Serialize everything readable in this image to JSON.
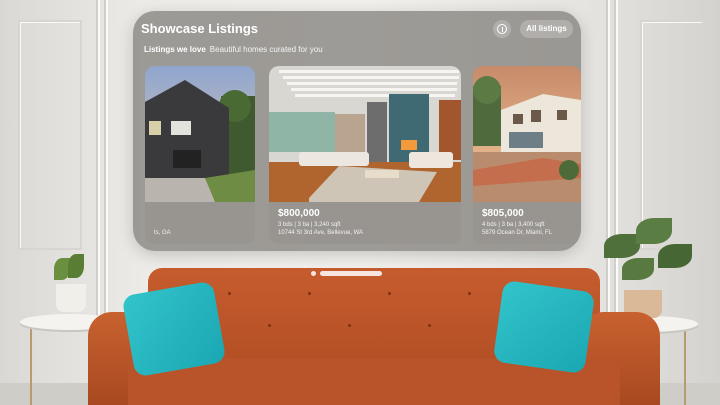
{
  "window": {
    "title": "Showcase Listings",
    "info_icon": "info-icon",
    "all_listings_label": "All listings"
  },
  "section": {
    "heading": "Listings we love",
    "subheading": "Beautiful homes curated for you"
  },
  "listings": [
    {
      "price": "",
      "specs": "",
      "address": "ts, GA",
      "photo": "modern two-story house with dark siding"
    },
    {
      "price": "$800,000",
      "specs": "3 bds | 3 ba | 3,240 sqft",
      "address": "10744 St 3rd Ave, Bellevue, WA",
      "photo": "open living room with fireplace"
    },
    {
      "price": "$805,000",
      "specs": "4 bds | 3 ba | 3,400 sqft",
      "address": "5879 Ocean Dr, Miami, FL",
      "photo": "mediterranean villa at sunset"
    }
  ],
  "colors": {
    "glass": "#7d7a76",
    "sofa": "#b9532a",
    "pillow": "#1aa7b3"
  }
}
